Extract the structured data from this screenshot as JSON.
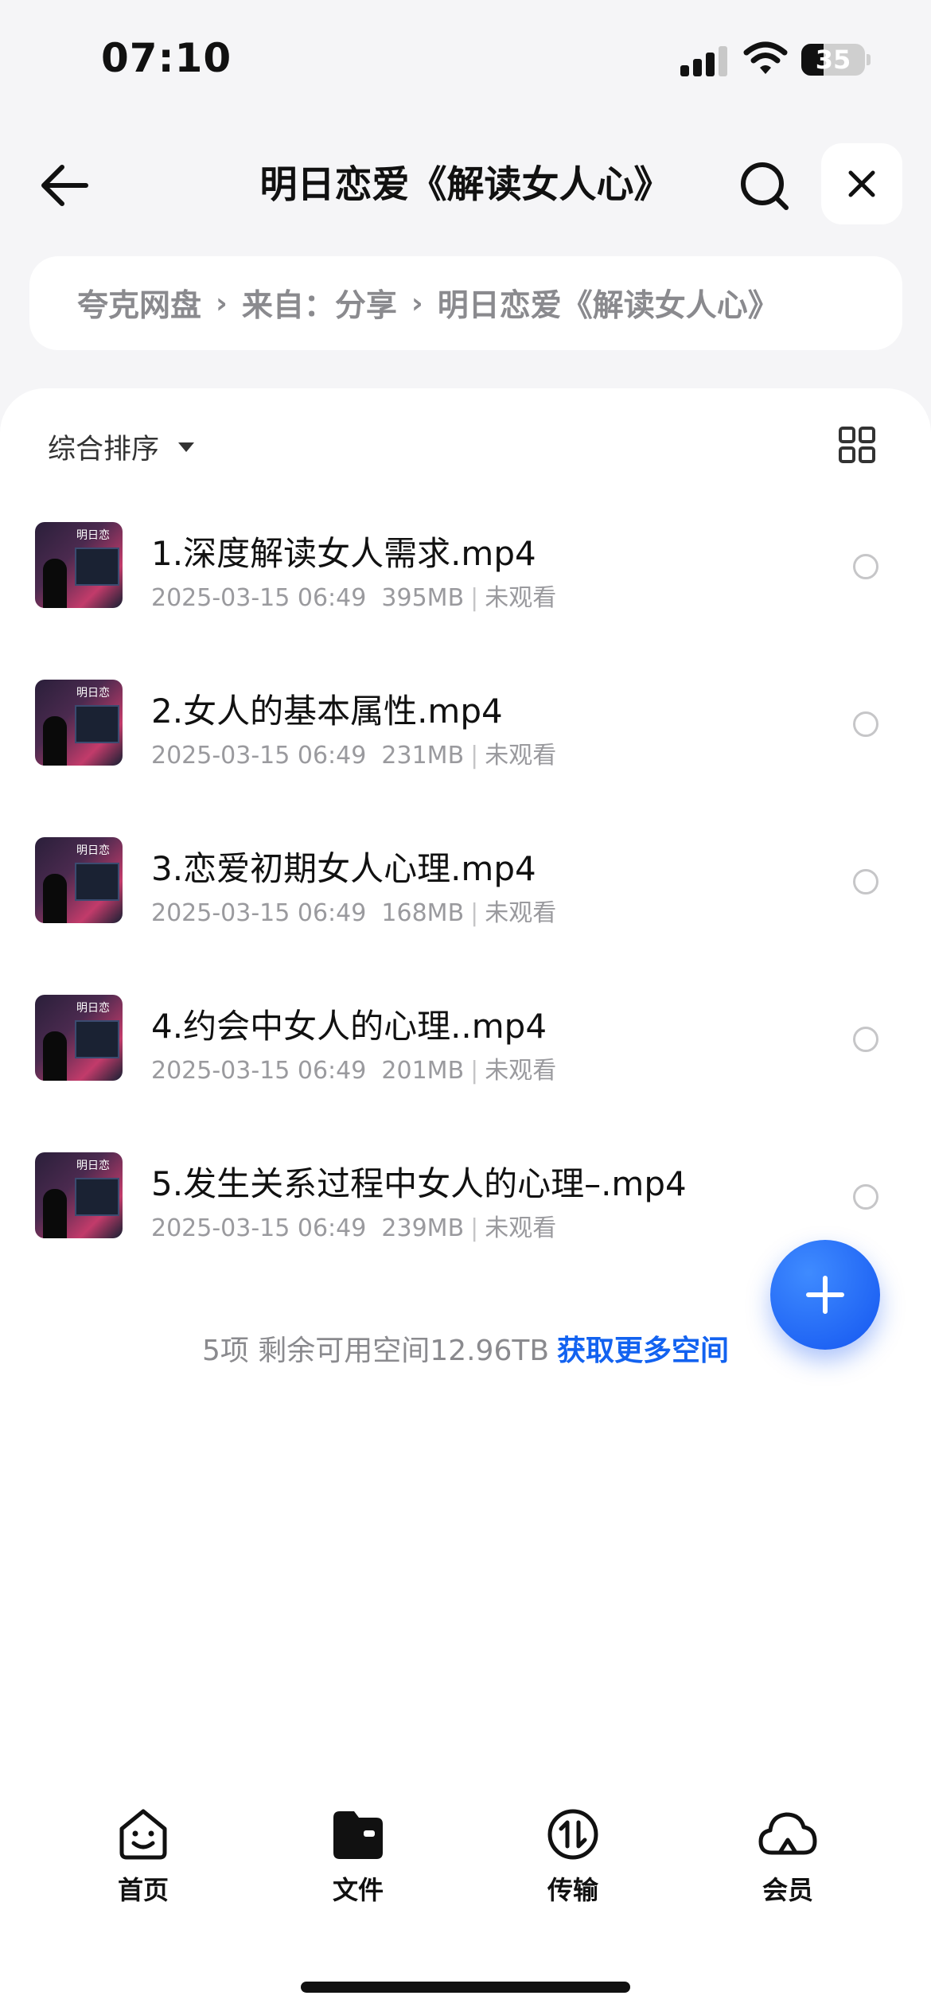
{
  "status_bar": {
    "time": "07:10",
    "battery": "35",
    "battery_level": 0.35
  },
  "header": {
    "title": "明日恋爱《解读女人心》"
  },
  "breadcrumb": [
    {
      "label": "夸克网盘"
    },
    {
      "label": "来自：分享"
    },
    {
      "label": "明日恋爱《解读女人心》"
    }
  ],
  "toolbar": {
    "sort_label": "综合排序"
  },
  "files": [
    {
      "name": "1.深度解读女人需求.mp4",
      "date": "2025-03-15 06:49",
      "size": "395MB",
      "status": "未观看"
    },
    {
      "name": "2.女人的基本属性.mp4",
      "date": "2025-03-15 06:49",
      "size": "231MB",
      "status": "未观看"
    },
    {
      "name": "3.恋爱初期女人心理.mp4",
      "date": "2025-03-15 06:49",
      "size": "168MB",
      "status": "未观看"
    },
    {
      "name": "4.约会中女人的心理..mp4",
      "date": "2025-03-15 06:49",
      "size": "201MB",
      "status": "未观看"
    },
    {
      "name": "5.发生关系过程中女人的心理–.mp4",
      "date": "2025-03-15 06:49",
      "size": "239MB",
      "status": "未观看"
    }
  ],
  "footer": {
    "summary": "5项 剩余可用空间12.96TB",
    "link": "获取更多空间"
  },
  "tabs": [
    {
      "label": "首页",
      "icon": "smiley-home-icon"
    },
    {
      "label": "文件",
      "icon": "folder-icon"
    },
    {
      "label": "传输",
      "icon": "transfer-icon"
    },
    {
      "label": "会员",
      "icon": "cloud-icon"
    }
  ],
  "colors": {
    "accent": "#1262f0",
    "background": "#f5f5f7"
  }
}
